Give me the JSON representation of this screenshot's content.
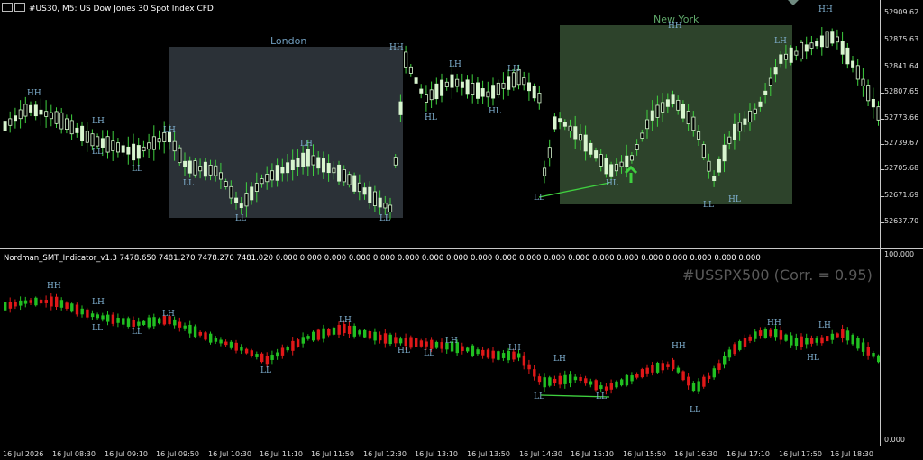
{
  "window": {
    "title": "#US30, M5:  US Dow Jones 30 Spot Index CFD"
  },
  "price_axis": {
    "labels": [
      "52909.62",
      "52875.63",
      "52841.64",
      "52807.65",
      "52773.66",
      "52739.67",
      "52705.68",
      "52671.69",
      "52637.70"
    ]
  },
  "sessions": {
    "london": {
      "label": "London",
      "color": "#3a424a"
    },
    "newyork": {
      "label": "New York",
      "color": "#3c5a3a"
    }
  },
  "main_swing_labels": [
    "HH",
    "LH",
    "LL",
    "LL",
    "LL",
    "LH",
    "LL",
    "LH",
    "LL",
    "HH",
    "HL",
    "LH",
    "HL",
    "LH",
    "LL",
    "HL",
    "HH",
    "LL",
    "HL",
    "LH",
    "HH"
  ],
  "indicator": {
    "name": "Nordman_SMT_Indicator_v1.3",
    "values": "7478.650 7481.270 7478.270 7481.020 0.000 0.000 0.000 0.000 0.000 0.000 0.000 0.000 0.000 0.000 0.000 0.000 0.000 0.000 0.000 0.000 0.000 0.000 0.000 0.000",
    "correlation_label": "#USSPX500 (Corr. = 0.95)",
    "axis_max": "100.000",
    "axis_min": "0.000"
  },
  "indicator_swing_labels": [
    "HH",
    "LH",
    "LL",
    "LL",
    "LH",
    "LL",
    "LH",
    "HL",
    "LL",
    "LH",
    "LH",
    "LL",
    "LH",
    "LL",
    "HH",
    "LL",
    "HH",
    "HL",
    "LH"
  ],
  "time_axis": {
    "labels": [
      "16 Jul 2026",
      "16 Jul 08:30",
      "16 Jul 09:10",
      "16 Jul 09:50",
      "16 Jul 10:30",
      "16 Jul 11:10",
      "16 Jul 11:50",
      "16 Jul 12:30",
      "16 Jul 13:10",
      "16 Jul 13:50",
      "16 Jul 14:30",
      "16 Jul 15:10",
      "16 Jul 15:50",
      "16 Jul 16:30",
      "16 Jul 17:10",
      "16 Jul 17:50",
      "16 Jul 18:30"
    ]
  },
  "colors": {
    "bull_main": "#d8f5cf",
    "wick_main": "#3fd03f",
    "bull_ind": "#21c021",
    "bear_ind": "#e01818",
    "smt_line": "#3fd03f",
    "arrow": "#3fd03f"
  }
}
